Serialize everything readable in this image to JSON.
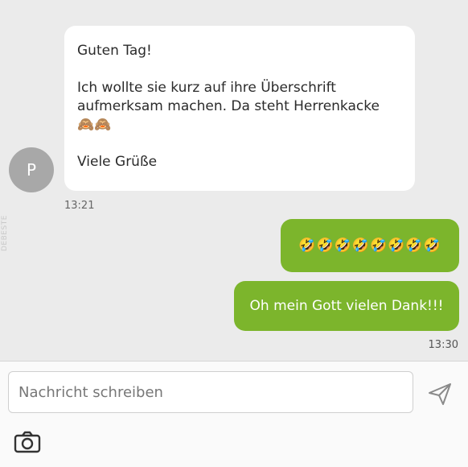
{
  "incoming": {
    "avatar_initial": "P",
    "greeting": "Guten Tag!",
    "body_line1": "Ich wollte sie kurz auf ihre Überschrift",
    "body_line2": "aufmerksam machen. Da steht Herrenkacke",
    "emojis": "🙈🙈",
    "signoff": "Viele Grüße",
    "time": "13:21"
  },
  "watermark": "DEBESTE",
  "outgoing": {
    "laugh_emojis": "🤣🤣🤣🤣🤣🤣🤣🤣",
    "reply": "Oh mein Gott vielen Dank!!!",
    "time": "13:30"
  },
  "composer": {
    "placeholder": "Nachricht schreiben",
    "send_icon": "send-icon",
    "camera_icon": "camera-icon"
  },
  "colors": {
    "outgoing_bubble": "#7cb52c",
    "incoming_bubble": "#ffffff",
    "avatar": "#a8a8a8",
    "chat_background": "#ebebeb"
  }
}
